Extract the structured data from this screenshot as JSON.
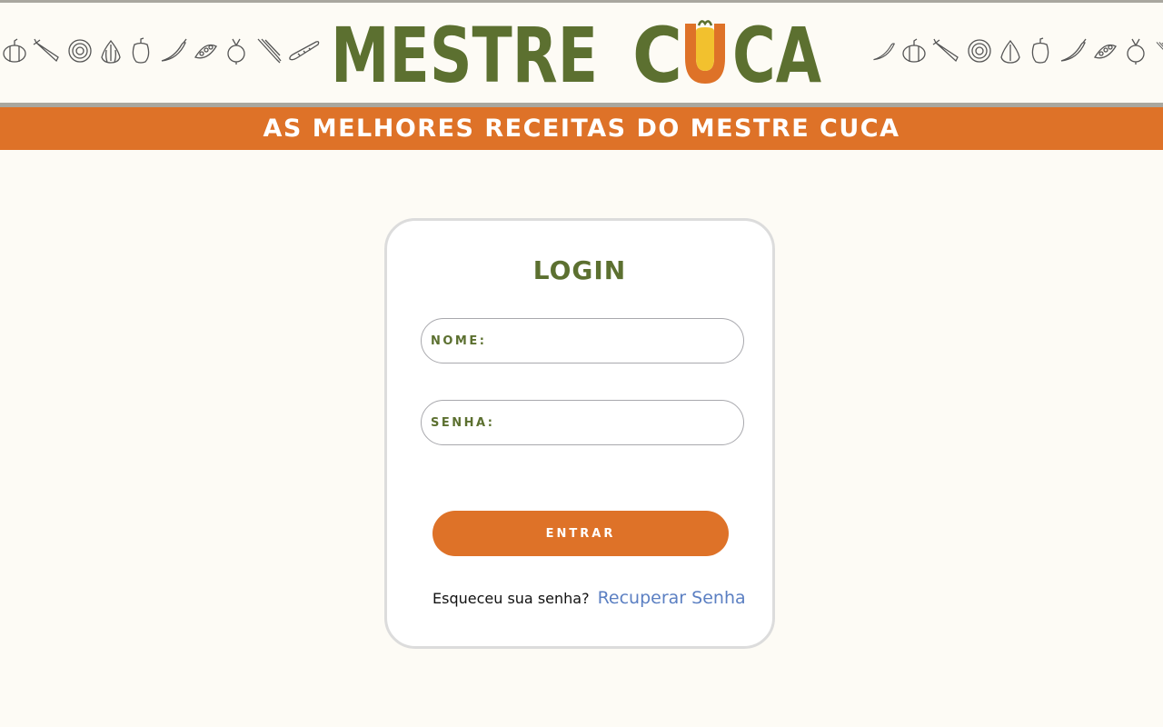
{
  "header": {
    "logo_text": "MESTRE CUCA",
    "logo_word1": "MESTRE",
    "logo_word2_parts": [
      "C",
      "U",
      "CA"
    ],
    "decoration_icons": [
      "pumpkin-icon",
      "carrot-icon",
      "onion-icon",
      "garlic-icon",
      "pepper-icon",
      "chili-icon",
      "peas-icon",
      "radish-icon",
      "scallion-icon",
      "cucumber-icon"
    ]
  },
  "banner": {
    "text": "AS MELHORES RECEITAS DO MESTRE CUCA"
  },
  "login": {
    "title": "LOGIN",
    "name_label": "NOME:",
    "name_value": "",
    "password_label": "SENHA:",
    "password_value": "",
    "submit_label": "ENTRAR",
    "forgot_text": "Esqueceu sua senha?",
    "recover_link": "Recuperar Senha"
  },
  "colors": {
    "background": "#fdfbf5",
    "brand_green": "#5c7030",
    "brand_orange": "#de7228",
    "logo_yellow": "#f2c12e",
    "link_blue": "#5b7fc2",
    "divider_gray": "#a9a79f"
  }
}
